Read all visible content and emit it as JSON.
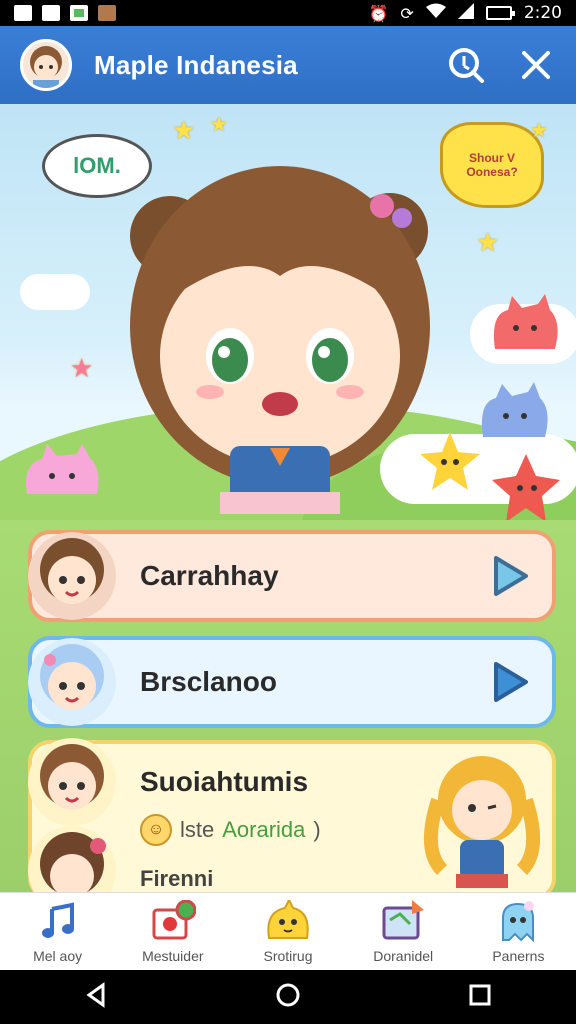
{
  "status_bar": {
    "time": "2:20",
    "icons": [
      "image-icon",
      "gallery-icon",
      "check-app-icon",
      "game-app-icon",
      "alarm-icon",
      "sync-icon",
      "wifi-icon",
      "signal-icon",
      "battery-icon"
    ]
  },
  "header": {
    "title": "Maple Indanesia",
    "actions": [
      "search-icon",
      "close-icon"
    ]
  },
  "hero": {
    "bubble_left": "lOM.",
    "bubble_right": "Shour V Oonesa?"
  },
  "list": [
    {
      "label": "Carrahhay",
      "action": "play-icon",
      "border": "#f0a071"
    },
    {
      "label": "Brsclanoo",
      "action": "play-icon",
      "border": "#6fb8ea"
    }
  ],
  "card3": {
    "title": "Suoiahtumis",
    "sub_prefix": "lste",
    "sub_accent": "Aorarida",
    "sub_suffix": ")",
    "peek": "Firenni"
  },
  "nav": [
    {
      "label": "Mel aoy",
      "icon": "music-note-icon"
    },
    {
      "label": "Mestuider",
      "icon": "camera-icon"
    },
    {
      "label": "Srotirug",
      "icon": "slime-icon"
    },
    {
      "label": "Doranidel",
      "icon": "map-icon"
    },
    {
      "label": "Panerns",
      "icon": "ghost-icon"
    }
  ],
  "colors": {
    "header": "#3a7fd6",
    "accent_green": "#45a03c",
    "play_blue": "#3d8fd6"
  }
}
